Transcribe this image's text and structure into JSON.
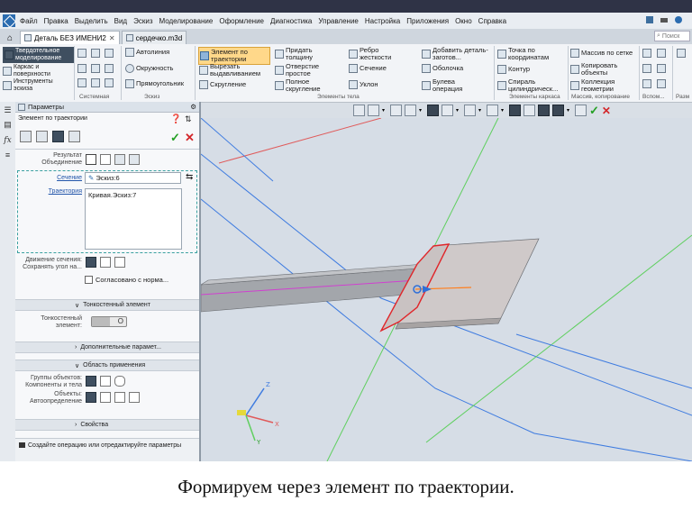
{
  "menu": {
    "items": [
      "Файл",
      "Правка",
      "Выделить",
      "Вид",
      "Эскиз",
      "Моделирование",
      "Оформление",
      "Диагностика",
      "Управление",
      "Настройка",
      "Приложения",
      "Окно",
      "Справка"
    ]
  },
  "tabs": {
    "doc1": "Деталь БЕЗ ИМЕНИ2",
    "doc2": "сердечко.m3d",
    "search_placeholder": "Поиск"
  },
  "ribbon": {
    "left": {
      "solid": "Твердотельное моделирование",
      "surfaces": "Каркас и поверхности",
      "sketch_tools": "Инструменты эскиза"
    },
    "groups": {
      "system": "Системная",
      "sketch": "Эскиз",
      "body_elements": "Элементы тела",
      "frame_elements": "Элементы каркаса",
      "copy_arrays": "Массив, копирование",
      "aux": "Вспом...",
      "markup": "Разм"
    },
    "buttons": {
      "autoline": "Автолиния",
      "circle": "Окружность",
      "rectangle": "Прямоугольник",
      "sweep": "Элемент по траектории",
      "cut_extrude": "Вырезать выдавливанием",
      "fillet": "Скругление",
      "thicken": "Придать толщину",
      "hole": "Отверстие простое",
      "shell_full": "Полное скругление",
      "rib": "Ребро жесткости",
      "section": "Сечение",
      "draft": "Уклон",
      "add_blank": "Добавить деталь-заготов...",
      "shell": "Оболочка",
      "boolean": "Булева операция",
      "point_coords": "Точка по координатам",
      "contour": "Контур",
      "spiral": "Спираль цилиндрическ...",
      "grid_array": "Массив по сетке",
      "copy_objects": "Копировать объекты",
      "geom_collection": "Коллекция геометрии"
    }
  },
  "panel": {
    "header": "Параметры",
    "subtitle": "Элемент по траектории",
    "result_label": "Результат Объединение",
    "section_label": "Сечение",
    "section_value": "Эскиз:6",
    "trajectory_label": "Траектория",
    "trajectory_value": "Кривая.Эскиз:7",
    "motion_label": "Движение сечения: Сохранять угол на...",
    "consistent_label": "Согласовано с норма...",
    "thin_section": "Тонкостенный элемент",
    "thin_label": "Тонкостенный элемент:",
    "extra_section": "Дополнительные парамет...",
    "scope_section": "Область применения",
    "groups_label": "Группы объектов: Компоненты и тела",
    "objects_label": "Объекты: Автоопределение",
    "props_section": "Свойства",
    "hint": "Создайте операцию или отредактируйте параметры"
  },
  "viewport": {
    "axis_labels": [
      "Z",
      "X",
      "Y"
    ],
    "colors": {
      "background": "#d6dde6",
      "solid": "#b7b9bd",
      "plate": "#cfc9c9",
      "selection": "#e0262a",
      "curve_blue": "#3e7be0",
      "curve_green": "#5fcf5f",
      "curve_red": "#e05a5a",
      "curve_orange": "#ff7f1e",
      "curve_magenta": "#d040d0"
    }
  },
  "caption": "Формируем через элемент по траектории."
}
